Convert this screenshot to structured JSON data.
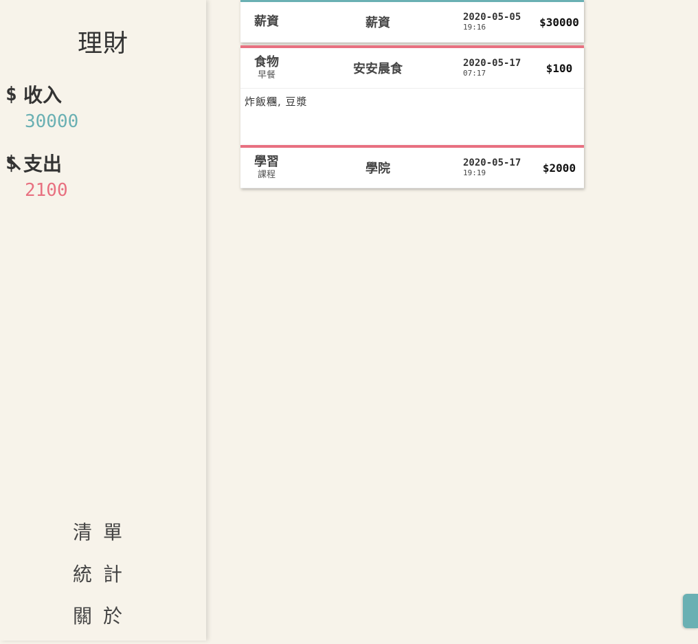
{
  "sidebar": {
    "title": "理財",
    "income": {
      "icon": "dollar-icon",
      "label": "收入",
      "value": "30000",
      "color": "#6ab0b3"
    },
    "expense": {
      "icon": "dollar-slash-icon",
      "label": "支出",
      "value": "2100",
      "color": "#e87080"
    },
    "nav": [
      {
        "label": "清單"
      },
      {
        "label": "統計"
      },
      {
        "label": "關於"
      }
    ]
  },
  "records": [
    {
      "type": "income",
      "category": "薪資",
      "subcategory": "",
      "name": "薪資",
      "date": "2020-05-05",
      "time": "19:16",
      "amount": "$30000",
      "note": ""
    },
    {
      "type": "expense",
      "category": "食物",
      "subcategory": "早餐",
      "name": "安安晨食",
      "date": "2020-05-17",
      "time": "07:17",
      "amount": "$100",
      "note": "炸飯糰, 豆漿"
    },
    {
      "type": "expense",
      "category": "學習",
      "subcategory": "課程",
      "name": "學院",
      "date": "2020-05-17",
      "time": "19:19",
      "amount": "$2000",
      "note": ""
    }
  ],
  "colors": {
    "income_accent": "#6ab0b3",
    "expense_accent": "#e87080",
    "background": "#f7f3ea"
  }
}
